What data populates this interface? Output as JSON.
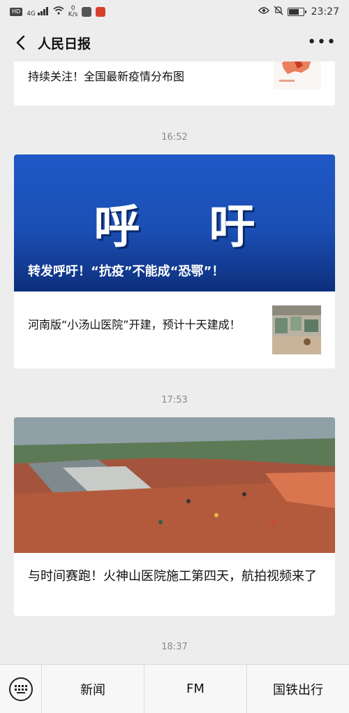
{
  "statusbar": {
    "hd_badge": "HD",
    "network": "4G",
    "speed_value": "0",
    "speed_unit": "K/s",
    "time": "23:27",
    "icons": [
      "signal-icon",
      "wifi-icon",
      "eye-icon",
      "mute-icon",
      "battery-icon"
    ]
  },
  "navbar": {
    "title": "人民日报",
    "more_label": "•••"
  },
  "feed": {
    "article1": {
      "title": "持续关注！全国最新疫情分布图"
    },
    "time1": "16:52",
    "article2": {
      "banner_big_text": "呼 吁",
      "banner_caption": "转发呼吁！“抗疫”不能成“恐鄂”！",
      "sub_title": "河南版“小汤山医院”开建，预计十天建成！"
    },
    "time2": "17:53",
    "article3": {
      "title": "与时间赛跑！火神山医院施工第四天，航拍视频来了"
    },
    "time3": "18:37"
  },
  "bottom_menu": {
    "items": [
      "新闻",
      "FM",
      "国铁出行"
    ]
  },
  "colors": {
    "background": "#ededed",
    "banner_blue": "#1f58c6",
    "text": "#111111",
    "time_gray": "#888888"
  }
}
